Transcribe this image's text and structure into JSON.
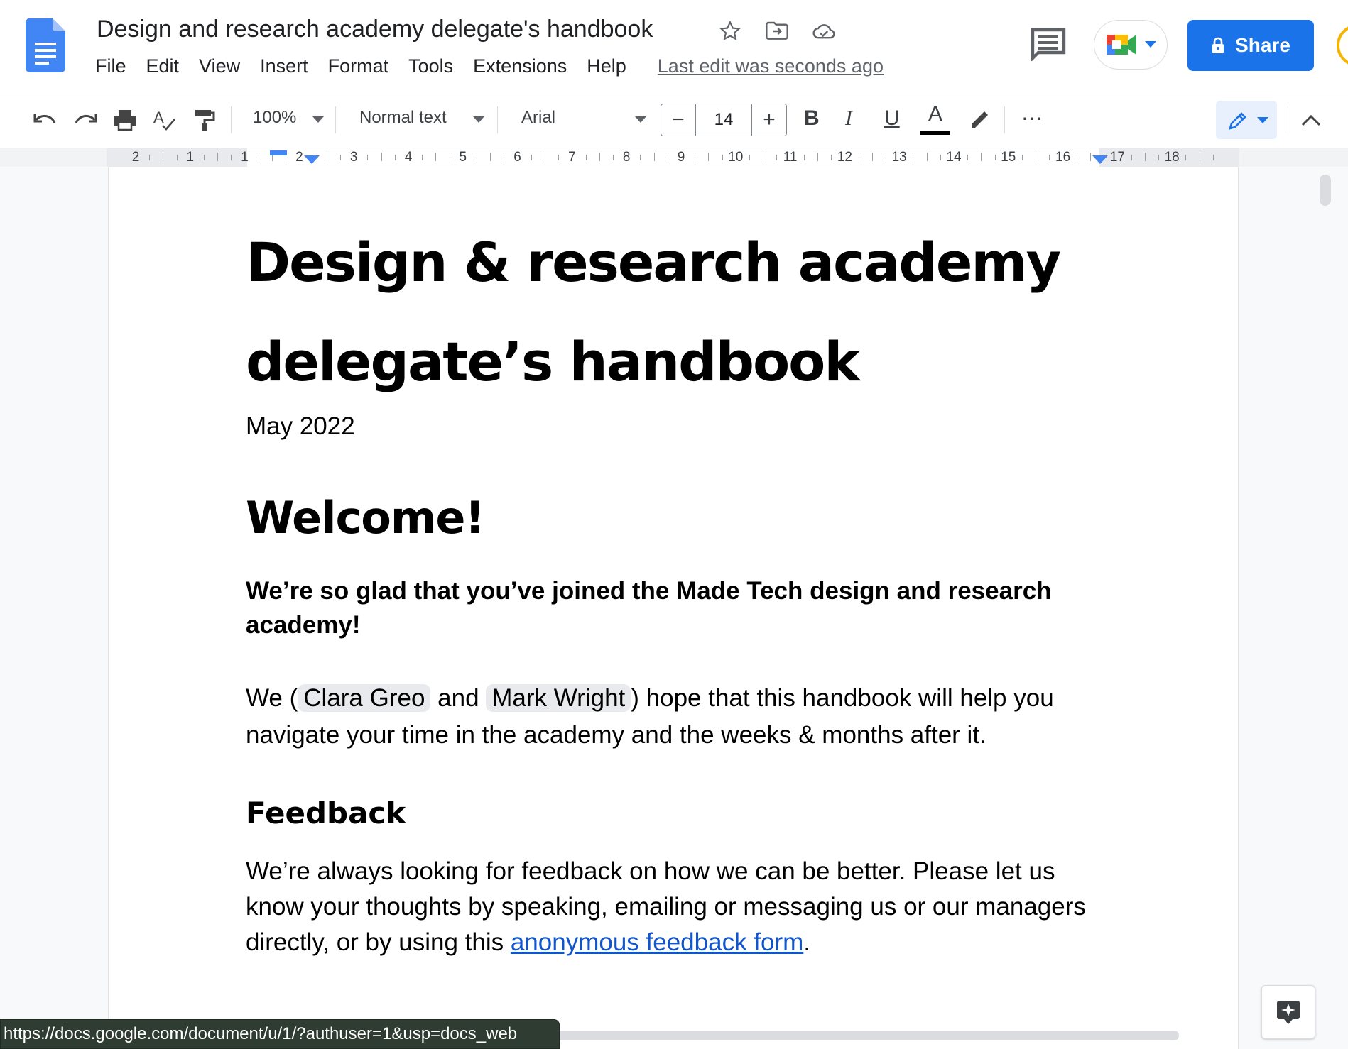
{
  "app": {
    "doc_title": "Design and research academy delegate's handbook",
    "menu": [
      "File",
      "Edit",
      "View",
      "Insert",
      "Format",
      "Tools",
      "Extensions",
      "Help"
    ],
    "last_edit": "Last edit was seconds ago",
    "share_label": "Share",
    "title_icons": [
      "star-icon",
      "move-to-folder-icon",
      "cloud-status-icon"
    ],
    "brand_color": "#1a73e8"
  },
  "toolbar": {
    "zoom": "100%",
    "style": "Normal text",
    "font": "Arial",
    "font_size": "14",
    "minus": "−",
    "plus": "+",
    "bold": "B",
    "italic": "I",
    "underline": "U",
    "text_color": "A",
    "more": "⋯"
  },
  "ruler": {
    "labels": [
      "2",
      "1",
      "1",
      "2",
      "3",
      "4",
      "5",
      "6",
      "7",
      "8",
      "9",
      "10",
      "11",
      "12",
      "13",
      "14",
      "15",
      "16",
      "17",
      "18"
    ]
  },
  "document": {
    "title_line1": "Design & research academy",
    "title_line2": "delegate’s handbook",
    "date": "May 2022",
    "welcome": "Welcome!",
    "intro": "We’re so glad that you’ve joined the Made Tech design and research academy!",
    "para1_a": "We (",
    "person1": "Clara Greo",
    "para1_b": " and ",
    "person2": "Mark Wright",
    "para1_c": ") hope that this handbook will help you navigate your time in the academy and the weeks & months after it.",
    "feedback_heading": "Feedback",
    "feedback_text": "We’re always looking for feedback on how we can be better.  Please let us know your thoughts by speaking, emailing or messaging us or our managers directly, or by using this ",
    "feedback_link": "anonymous feedback form",
    "feedback_end": "."
  },
  "status_url": "https://docs.google.com/document/u/1/?authuser=1&usp=docs_web"
}
